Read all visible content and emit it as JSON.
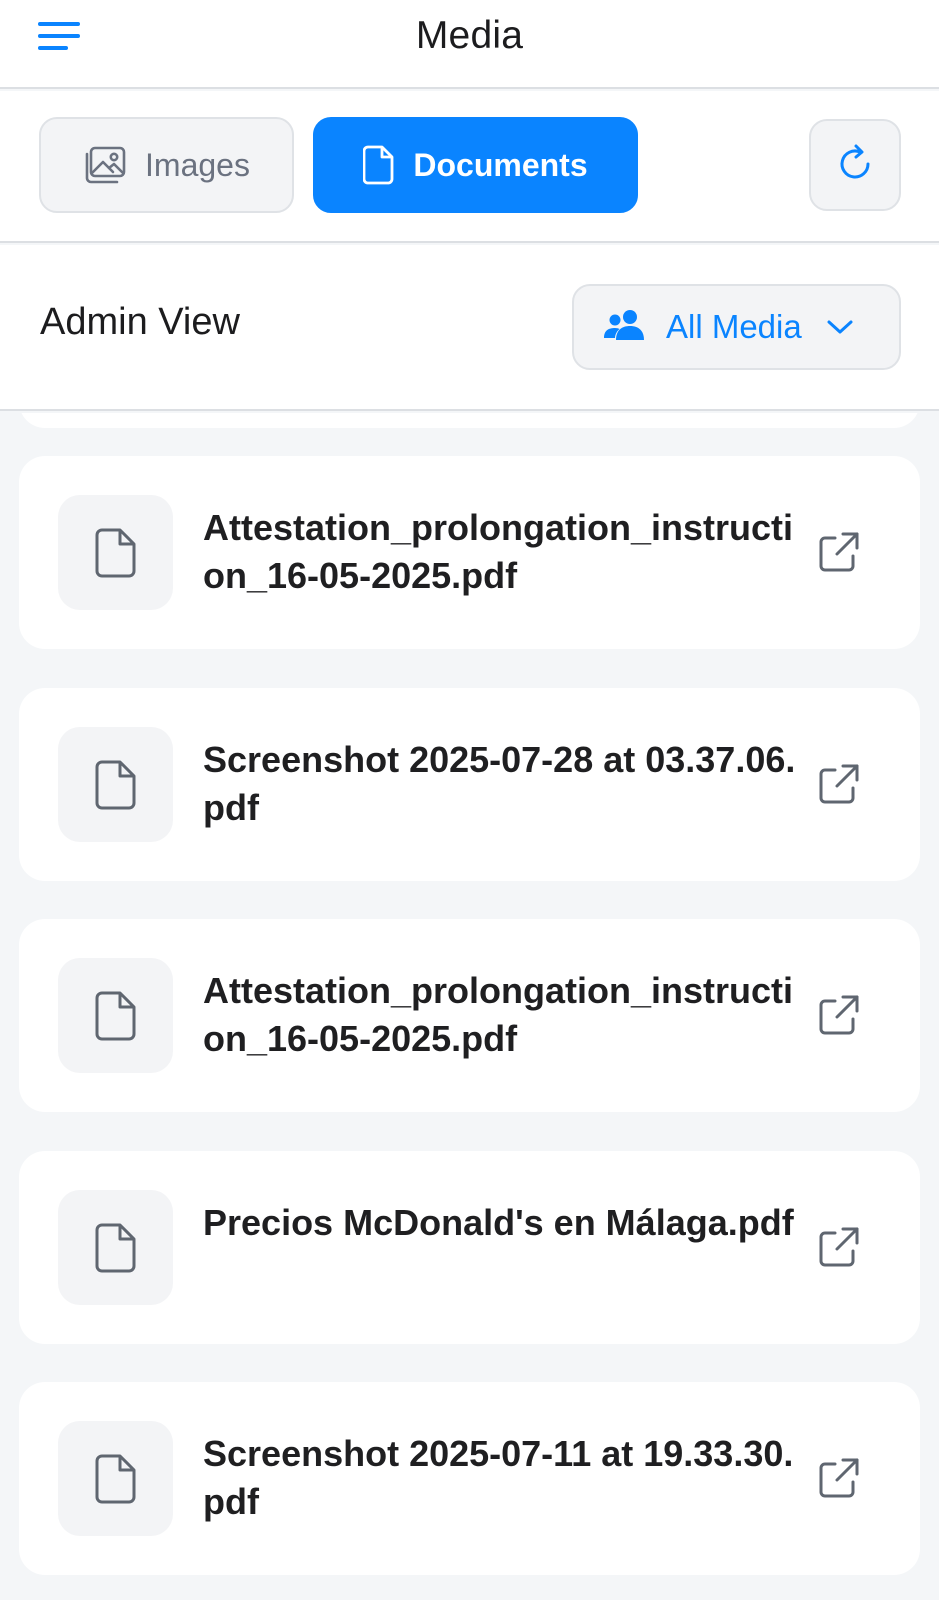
{
  "header": {
    "title": "Media",
    "menu_icon": "hamburger-menu-icon"
  },
  "tabs": [
    {
      "label": "Images",
      "icon": "image-icon",
      "active": false
    },
    {
      "label": "Documents",
      "icon": "document-icon",
      "active": true
    }
  ],
  "refresh": {
    "icon": "refresh-icon"
  },
  "admin": {
    "title": "Admin View",
    "filter": {
      "label": "All Media",
      "icon": "users-icon",
      "chevron": "chevron-down-icon"
    }
  },
  "documents": [
    {
      "name": "Attestation_prolongation_instruction_16-05-2025.pdf"
    },
    {
      "name": "Screenshot 2025-07-28 at 03.37.06.pdf"
    },
    {
      "name": "Attestation_prolongation_instruction_16-05-2025.pdf"
    },
    {
      "name": "Precios McDonald's en Málaga.pdf"
    },
    {
      "name": "Screenshot 2025-07-11 at 19.33.30.pdf"
    }
  ],
  "colors": {
    "accent": "#0a84ff",
    "background": "#f4f6f8",
    "card": "#ffffff",
    "muted_text": "#6b7280"
  }
}
